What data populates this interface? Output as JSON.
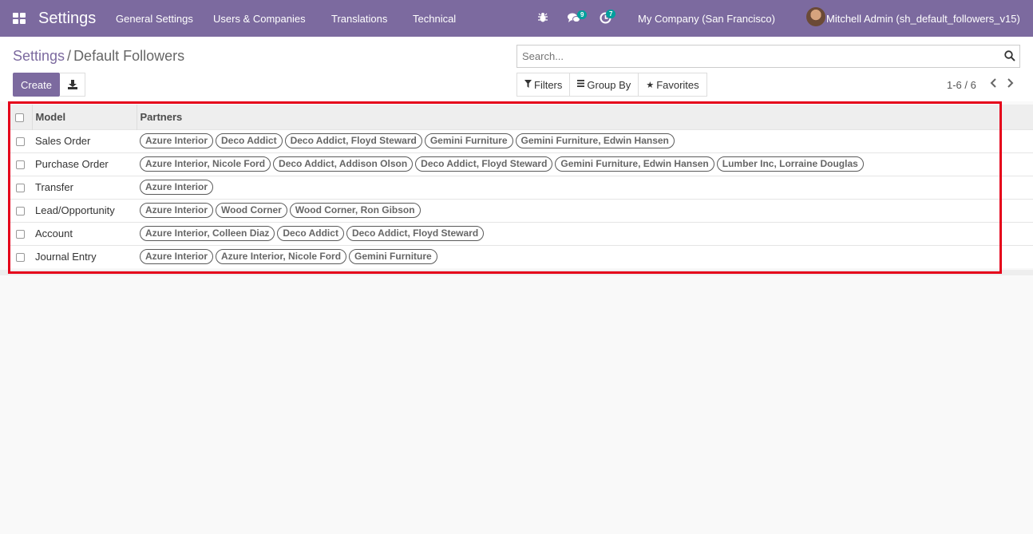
{
  "navbar": {
    "brand": "Settings",
    "menu": [
      "General Settings",
      "Users & Companies",
      "Translations",
      "Technical"
    ],
    "chat_count": "9",
    "activity_count": "7",
    "company": "My Company (San Francisco)",
    "user": "Mitchell Admin (sh_default_followers_v15)"
  },
  "breadcrumb": {
    "parent": "Settings",
    "separator": "/",
    "current": "Default Followers"
  },
  "toolbar": {
    "create_label": "Create"
  },
  "search": {
    "placeholder": "Search..."
  },
  "filters": {
    "filters_label": "Filters",
    "groupby_label": "Group By",
    "favorites_label": "Favorites"
  },
  "pager": {
    "value": "1-6 / 6"
  },
  "table": {
    "headers": {
      "model": "Model",
      "partners": "Partners"
    },
    "rows": [
      {
        "model": "Sales Order",
        "partners": [
          "Azure Interior",
          "Deco Addict",
          "Deco Addict, Floyd Steward",
          "Gemini Furniture",
          "Gemini Furniture, Edwin Hansen"
        ]
      },
      {
        "model": "Purchase Order",
        "partners": [
          "Azure Interior, Nicole Ford",
          "Deco Addict, Addison Olson",
          "Deco Addict, Floyd Steward",
          "Gemini Furniture, Edwin Hansen",
          "Lumber Inc, Lorraine Douglas"
        ]
      },
      {
        "model": "Transfer",
        "partners": [
          "Azure Interior"
        ]
      },
      {
        "model": "Lead/Opportunity",
        "partners": [
          "Azure Interior",
          "Wood Corner",
          "Wood Corner, Ron Gibson"
        ]
      },
      {
        "model": "Account",
        "partners": [
          "Azure Interior, Colleen Diaz",
          "Deco Addict",
          "Deco Addict, Floyd Steward"
        ]
      },
      {
        "model": "Journal Entry",
        "partners": [
          "Azure Interior",
          "Azure Interior, Nicole Ford",
          "Gemini Furniture"
        ]
      }
    ]
  },
  "colors": {
    "navbar": "#7c6a9f",
    "badge": "#00a09d",
    "highlight": "#e5001a"
  }
}
